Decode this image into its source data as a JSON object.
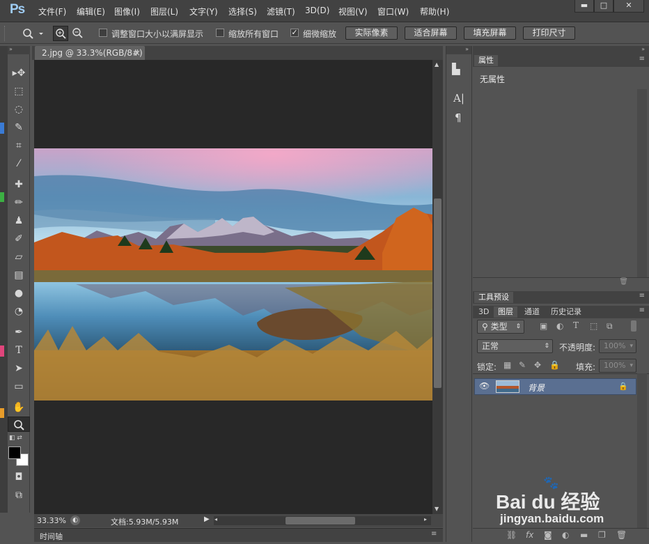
{
  "app": {
    "logo": "Ps"
  },
  "menu": [
    "文件(F)",
    "编辑(E)",
    "图像(I)",
    "图层(L)",
    "文字(Y)",
    "选择(S)",
    "滤镜(T)",
    "3D(D)",
    "视图(V)",
    "窗口(W)",
    "帮助(H)"
  ],
  "window_buttons": {
    "minimize": "▬",
    "maximize": "□",
    "close": "✕"
  },
  "options": {
    "resize_windows": {
      "label": "调整窗口大小以满屏显示",
      "checked": false
    },
    "zoom_all": {
      "label": "缩放所有窗口",
      "checked": false
    },
    "scrubby": {
      "label": "细微缩放",
      "checked": true
    },
    "actual_pixels": "实际像素",
    "fit_screen": "适合屏幕",
    "fill_screen": "填充屏幕",
    "print_size": "打印尺寸"
  },
  "document": {
    "tab_title": "2.jpg @ 33.3%(RGB/8#)",
    "tab_close": "×",
    "zoom": "33.33%",
    "doc_size": "文档:5.93M/5.93M"
  },
  "timeline": {
    "label": "时间轴"
  },
  "properties_panel": {
    "tab": "属性",
    "content": "无属性"
  },
  "tool_presets": {
    "tab": "工具预设"
  },
  "layers_panel": {
    "tabs": [
      "3D",
      "图层",
      "通道",
      "历史记录"
    ],
    "filter_kind": "类型",
    "blend_mode": "正常",
    "opacity_label": "不透明度:",
    "opacity_value": "100%",
    "lock_label": "锁定:",
    "fill_label": "填充:",
    "fill_value": "100%",
    "layers": [
      {
        "name": "背景",
        "visible": true,
        "locked": true
      }
    ]
  },
  "watermark": {
    "brand": "Bai du 经验",
    "url": "jingyan.baidu.com"
  },
  "colors": {
    "foreground": "#000000",
    "background": "#ffffff",
    "logo": "#9fcdf5"
  }
}
